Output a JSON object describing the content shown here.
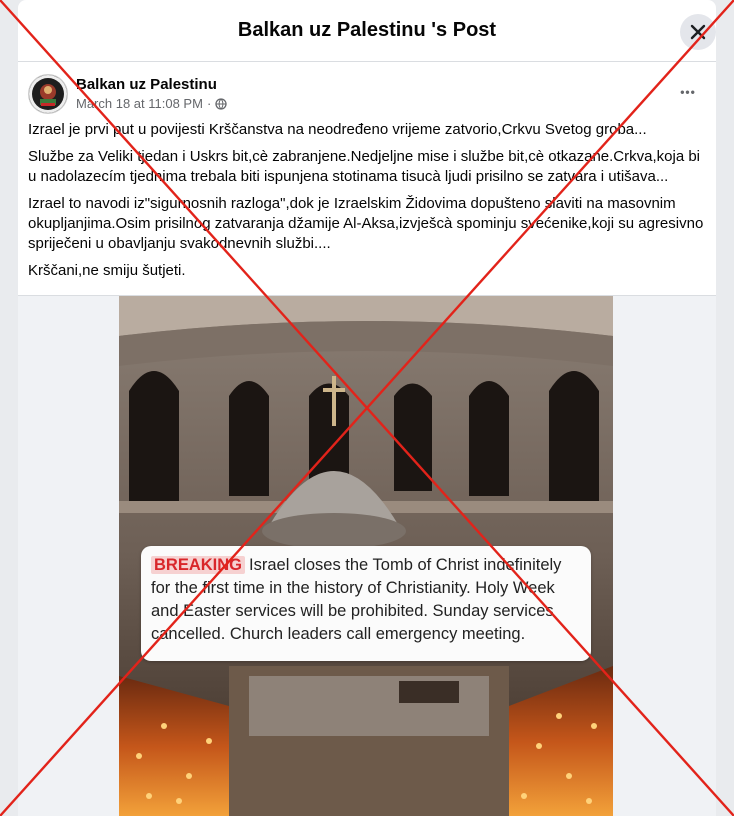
{
  "dialog": {
    "title": "Balkan uz Palestinu 's Post",
    "close_icon": "close-icon"
  },
  "post": {
    "author": "Balkan uz Palestinu",
    "timestamp": "March 18 at 11:08 PM",
    "separator": "·",
    "privacy_icon": "globe-icon",
    "more_icon": "more-options-icon",
    "more_label": "•••",
    "paragraphs": [
      "Izrael je prvi put u povijesti Krščanstva na neodređeno vrijeme zatvorio,Crkvu Svetog groba...",
      "Službe za Veliki tjedan i Uskrs bit,cè zabranjene.Nedjeljne mise i službe bit,cè otkazane.Crkva,koja bi u nadolazecím tjednima trebala biti ispunjena stotinama tisucà ljudi prisilno se zatvara i utišava...",
      "Izrael to navodi iz\"sigurnosnih razloga\",dok je Izraelskim Židovima dopušteno slaviti na masovnim okupljanjima.Osim prisilnog zatvaranja džamije Al-Aksa,izvješcà spominju svećenike,koji su agresivno spriječeni u obavljanju svakodnevnih službi....",
      "Krščani,ne smiju šutjeti."
    ]
  },
  "image": {
    "breaking_label": "BREAKING",
    "breaking_text": "Israel closes the Tomb of Christ indefinitely for the first time in the history of Christianity. Holy Week and Easter services will be prohibited. Sunday services cancelled. Church leaders call emergency meeting."
  },
  "colors": {
    "cross_overlay": "#e2231a",
    "breaking_red": "#d9262b"
  }
}
